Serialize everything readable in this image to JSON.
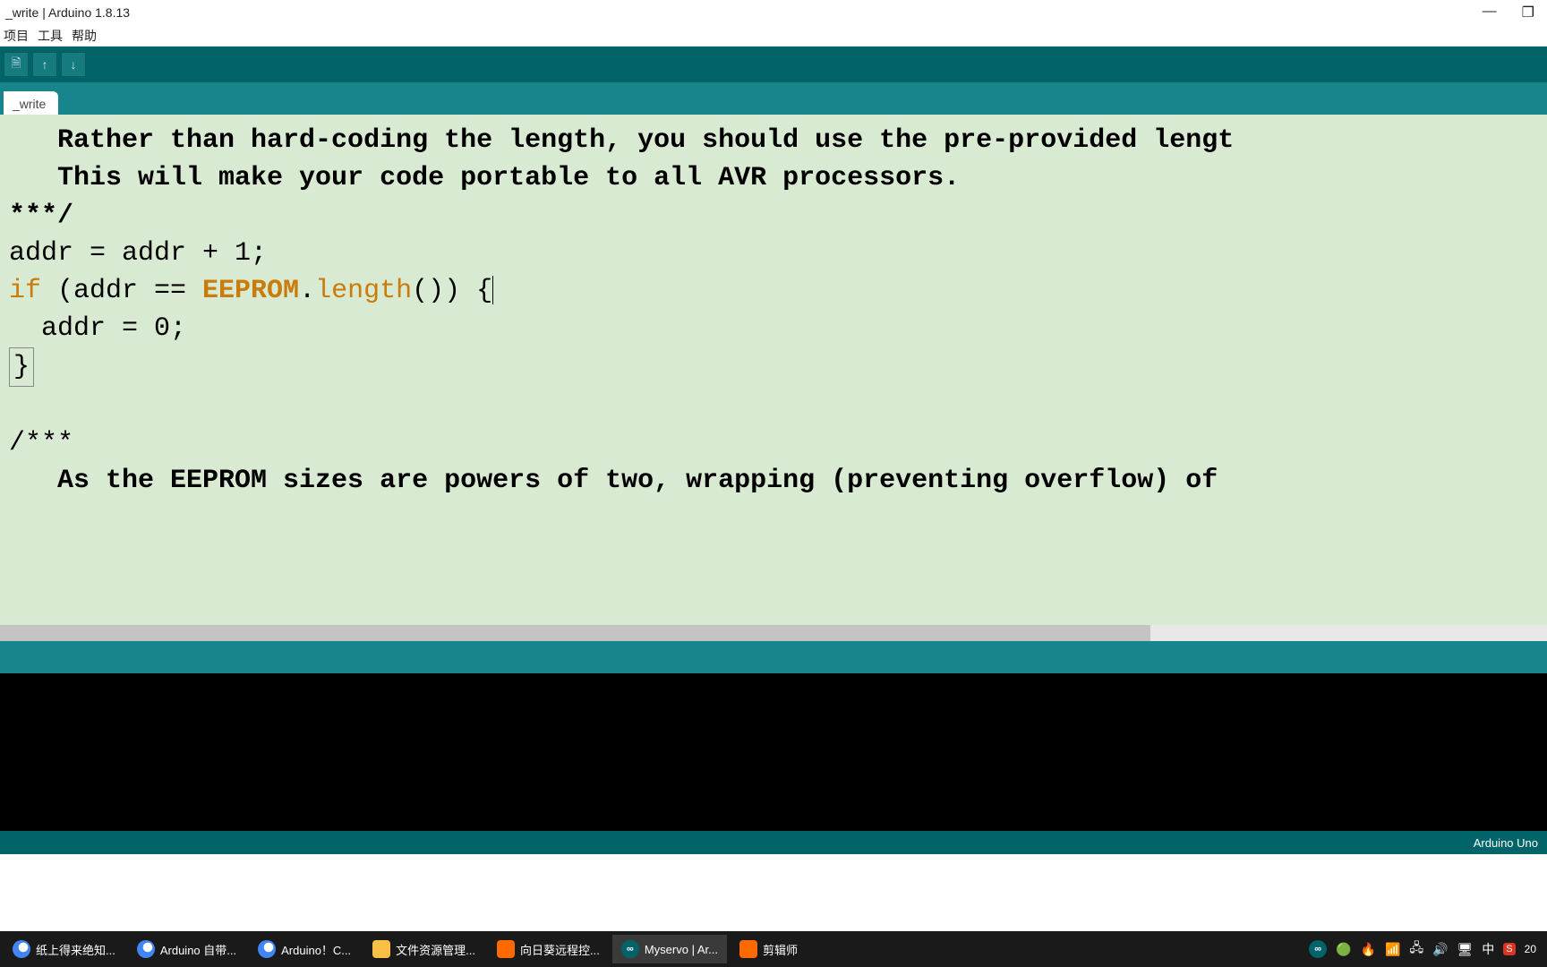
{
  "window": {
    "title": "_write | Arduino 1.8.13"
  },
  "menu": {
    "project": "项目",
    "tools": "工具",
    "help": "帮助"
  },
  "tab": {
    "name": "_write"
  },
  "code": {
    "l1": "   Rather than hard-coding the length, you should use the pre-provided lengt",
    "l2": "   This will make your code portable to all AVR processors.",
    "l3": "***/",
    "l4a": "addr = addr + 1;",
    "l5a": "if",
    "l5b": " (addr == ",
    "l5c": "EEPROM",
    "l5d": ".",
    "l5e": "length",
    "l5f": "()) {",
    "l6": "  addr = 0;",
    "l7": "}",
    "l8": " ",
    "l9": "/***",
    "l10": "   As the EEPROM sizes are powers of two, wrapping (preventing overflow) of"
  },
  "footer": {
    "board": "Arduino Uno"
  },
  "taskbar": {
    "t1": "纸上得来绝知...",
    "t2": "Arduino 自带...",
    "t3": "Arduino！C...",
    "t4": "文件资源管理...",
    "t5": "向日葵远程控...",
    "t6": "Myservo | Ar...",
    "t7": "剪辑师"
  },
  "tray": {
    "ime": "中",
    "time": "20"
  },
  "icons": {
    "file": "🗎",
    "up": "↑",
    "down": "↓",
    "minimize": "—",
    "maximize": "❐",
    "infinity": "∞",
    "wifi": "⌂",
    "sound": "🔊",
    "net": "🖧"
  }
}
